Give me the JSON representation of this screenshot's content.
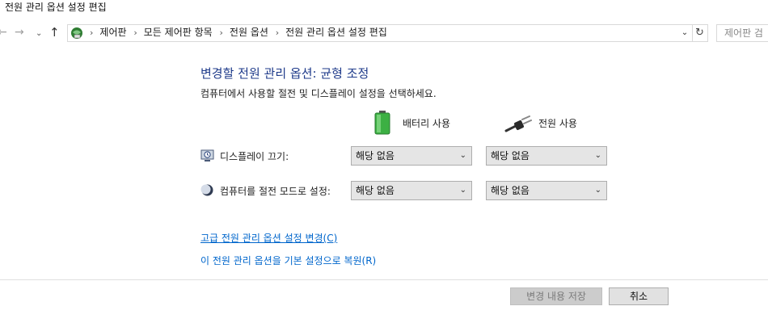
{
  "window": {
    "title": "전원 관리 옵션 설정 편집"
  },
  "nav": {
    "back_glyph": "←",
    "forward_glyph": "→",
    "recent_glyph": "⌄",
    "up_glyph": "↑",
    "address_crumbs": [
      "제어판",
      "모든 제어판 항목",
      "전원 옵션",
      "전원 관리 옵션 설정 편집"
    ],
    "crumb_separator": "›",
    "refresh_glyph": "↻",
    "search_placeholder": "제어판 검"
  },
  "main": {
    "heading": "변경할 전원 관리 옵션: 균형 조정",
    "description": "컴퓨터에서 사용할 절전 및 디스플레이 설정을 선택하세요.",
    "columns": {
      "battery": "배터리 사용",
      "plugged_in": "전원 사용"
    },
    "settings": [
      {
        "label": "디스플레이 끄기:",
        "battery_value": "해당 없음",
        "plugged_value": "해당 없음"
      },
      {
        "label": "컴퓨터를 절전 모드로 설정:",
        "battery_value": "해당 없음",
        "plugged_value": "해당 없음"
      }
    ],
    "links": {
      "advanced": "고급 전원 관리 옵션 설정 변경(C)",
      "restore": "이 전원 관리 옵션을 기본 설정으로 복원(R)"
    }
  },
  "footer": {
    "save_label": "변경 내용 저장",
    "cancel_label": "취소"
  },
  "colors": {
    "heading": "#1e3a8a",
    "link": "#0066cc",
    "battery_green": "#3cb043"
  }
}
